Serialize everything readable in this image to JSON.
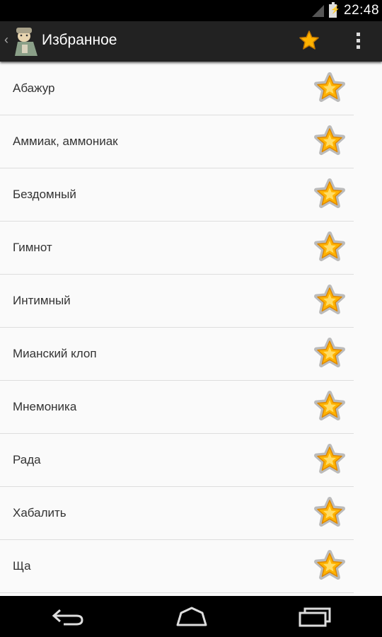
{
  "status_bar": {
    "time": "22:48"
  },
  "action_bar": {
    "title": "Избранное",
    "back_icon": "chevron-left-icon",
    "app_icon": "app-avatar-icon",
    "favorite_icon": "star-icon",
    "overflow_icon": "overflow-menu-icon"
  },
  "favorites": [
    {
      "word": "Абажур"
    },
    {
      "word": "Аммиак, аммониак"
    },
    {
      "word": "Бездомный"
    },
    {
      "word": "Гимнот"
    },
    {
      "word": "Интимный"
    },
    {
      "word": "Мианский клоп"
    },
    {
      "word": "Мнемоника"
    },
    {
      "word": "Рада"
    },
    {
      "word": "Хабалить"
    },
    {
      "word": "Ща"
    }
  ],
  "nav_bar": {
    "back": "back-icon",
    "home": "home-icon",
    "recents": "recents-icon"
  },
  "colors": {
    "star_fill": "#ffb300",
    "star_center": "#ffe680",
    "action_bar": "#222222",
    "background": "#fafafa"
  }
}
